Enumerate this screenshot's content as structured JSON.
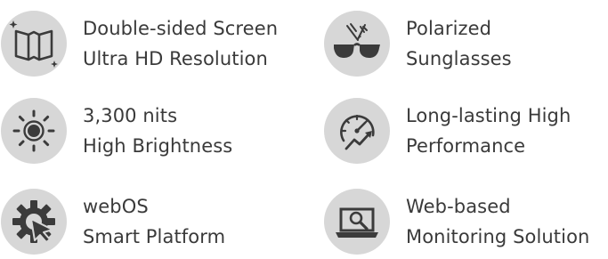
{
  "features": [
    {
      "icon": "double-sided-screen-icon",
      "line1": "Double-sided Screen",
      "line2": "Ultra HD Resolution"
    },
    {
      "icon": "polarized-sunglasses-icon",
      "line1": "Polarized",
      "line2": "Sunglasses"
    },
    {
      "icon": "brightness-sun-icon",
      "line1": "3,300 nits",
      "line2": "High Brightness"
    },
    {
      "icon": "performance-gauge-icon",
      "line1": "Long-lasting High",
      "line2": "Performance"
    },
    {
      "icon": "webos-gear-cursor-icon",
      "line1": "webOS",
      "line2": "Smart Platform"
    },
    {
      "icon": "web-monitoring-laptop-icon",
      "line1": "Web-based",
      "line2": "Monitoring Solution"
    }
  ],
  "colors": {
    "icon_background": "#d7d7d7",
    "icon_foreground": "#3b3b3b",
    "text": "#3a3a3a"
  }
}
